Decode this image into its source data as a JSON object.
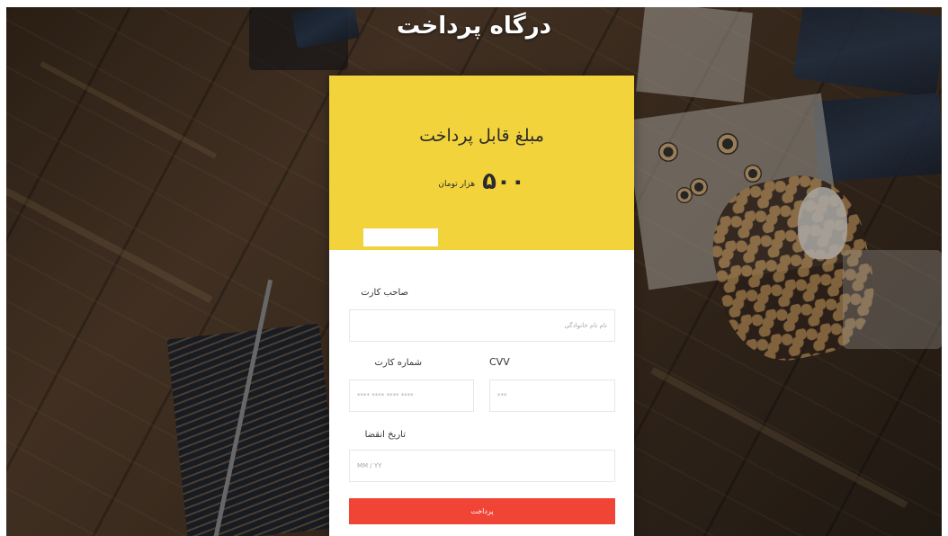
{
  "page": {
    "title": "درگاه پرداخت"
  },
  "card": {
    "amount_label": "مبلغ قابل پرداخت",
    "amount_value": "۵۰۰",
    "amount_unit": "هزار تومان"
  },
  "form": {
    "holder": {
      "label": "صاحب کارت",
      "placeholder": "نام نام خانوادگی"
    },
    "card_number": {
      "label": "شماره کارت",
      "placeholder": "**** **** **** ****"
    },
    "cvv": {
      "label": "CVV",
      "placeholder": "***"
    },
    "expiry": {
      "label": "تاریخ انقضا",
      "placeholder": "MM / YY"
    },
    "submit_label": "پرداخت"
  },
  "colors": {
    "header_yellow": "#f2d33b",
    "button_red": "#f04436",
    "card_white": "#ffffff"
  }
}
